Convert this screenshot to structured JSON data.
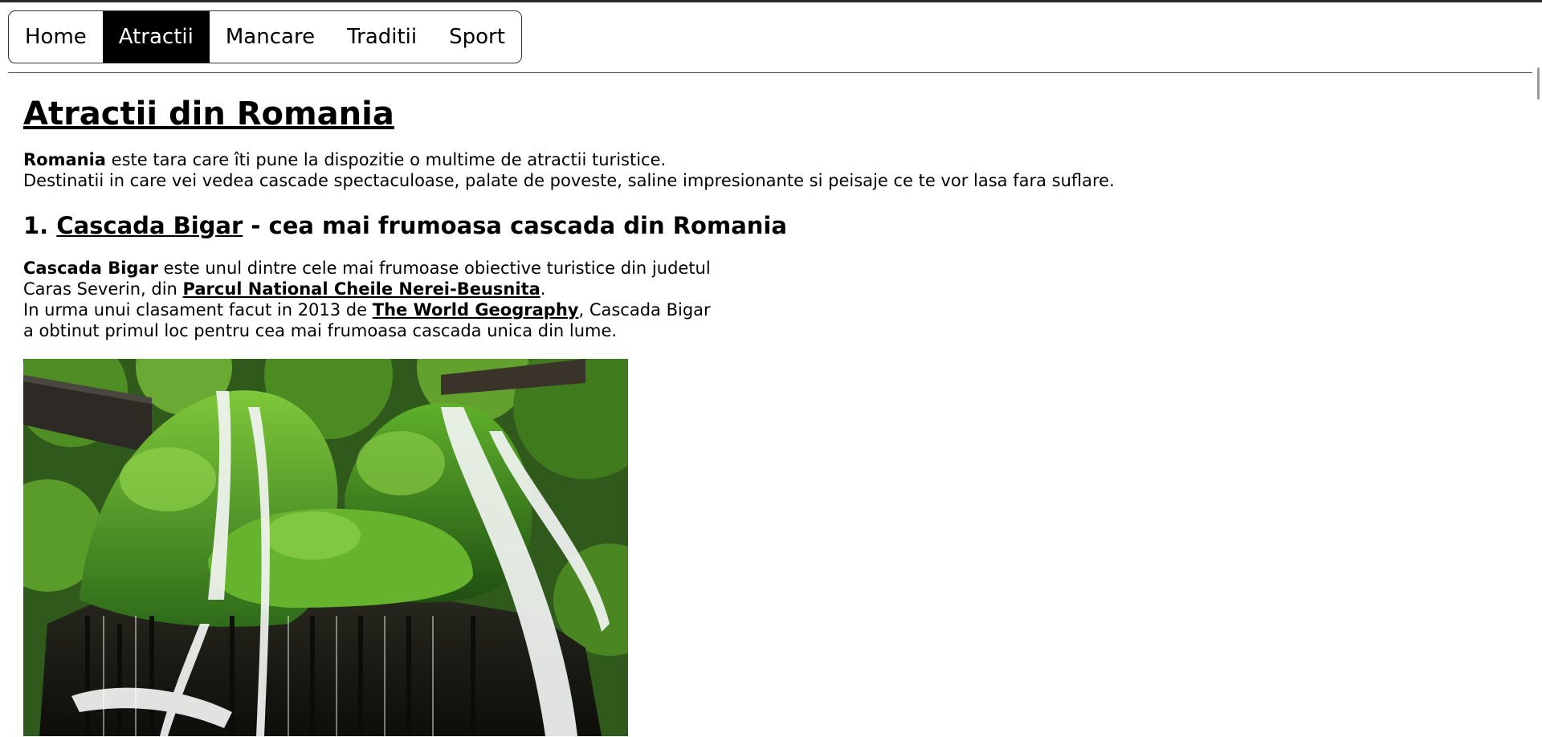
{
  "nav": {
    "items": [
      {
        "label": "Home"
      },
      {
        "label": "Atractii"
      },
      {
        "label": "Mancare"
      },
      {
        "label": "Traditii"
      },
      {
        "label": "Sport"
      }
    ],
    "active": "Atractii"
  },
  "page": {
    "title": "Atractii din Romania",
    "intro": {
      "bold": "Romania",
      "line1_rest": " este tara care îti pune la dispozitie o multime de atractii turistice.",
      "line2": "Destinatii in care vei vedea cascade spectaculoase, palate de poveste, saline impresionante si peisaje ce te vor lasa fara suflare."
    }
  },
  "section1": {
    "number": "1.",
    "link_label": "Cascada Bigar",
    "heading_rest": " - cea mai frumoasa cascada din Romania",
    "desc": {
      "bold": "Cascada Bigar",
      "part1": " este unul dintre cele mai frumoase obiective turistice din judetul",
      "part2": "Caras Severin, din ",
      "park_link": "Parcul National Cheile Nerei-Beusnita",
      "part3": ".",
      "part4": "In urma unui clasament facut in 2013 de ",
      "geo_link": "The World Geography",
      "part5": ", Cascada Bigar",
      "part6": "a obtinut primul loc pentru cea mai frumoasa cascada unica din lume."
    },
    "image": {
      "subject": "waterfall-photo"
    }
  },
  "colors": {
    "nav_active_bg": "#000000",
    "nav_active_text": "#ffffff",
    "text": "#000000"
  }
}
